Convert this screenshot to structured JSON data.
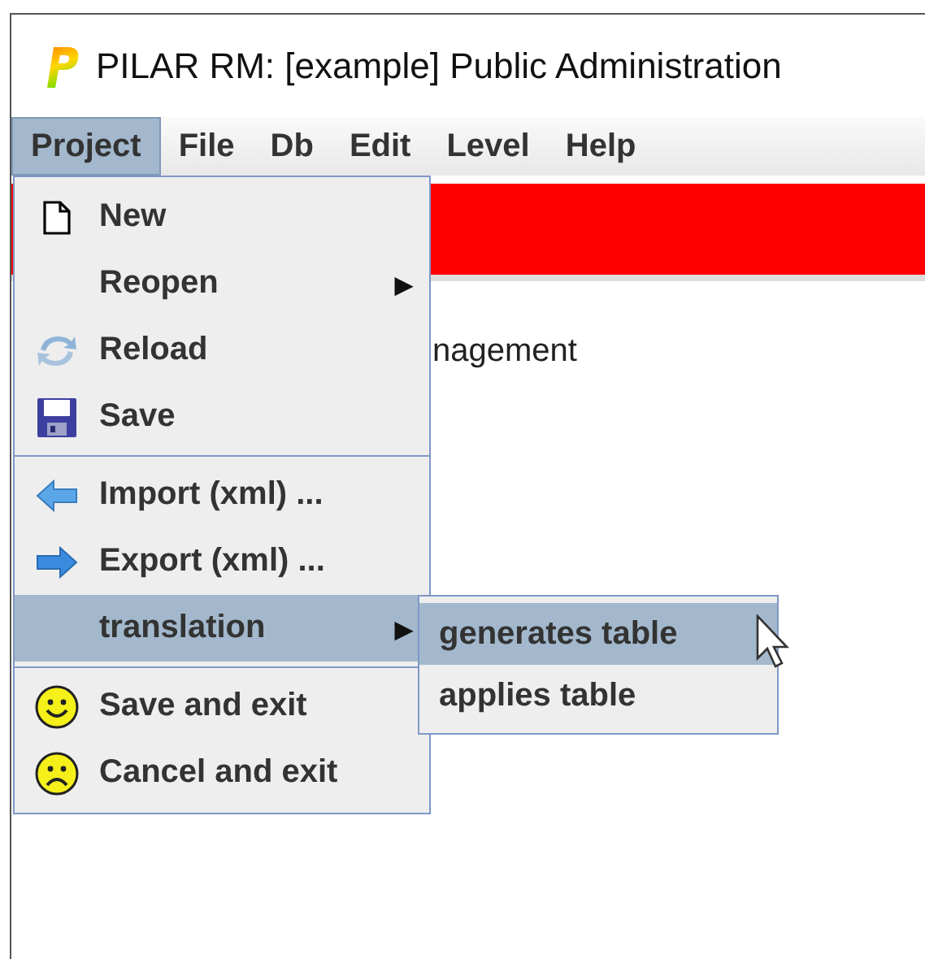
{
  "window": {
    "title": "PILAR RM: [example] Public Administration"
  },
  "menubar": [
    {
      "label": "Project",
      "selected": true
    },
    {
      "label": "File",
      "selected": false
    },
    {
      "label": "Db",
      "selected": false
    },
    {
      "label": "Edit",
      "selected": false
    },
    {
      "label": "Level",
      "selected": false
    },
    {
      "label": "Help",
      "selected": false
    }
  ],
  "content": {
    "text": "nagement"
  },
  "menu": [
    {
      "kind": "item",
      "label": "New",
      "selected": false
    },
    {
      "kind": "submenu",
      "label": "Reopen",
      "arrow": "▶",
      "selected": false
    },
    {
      "kind": "item",
      "label": "Reload",
      "selected": false
    },
    {
      "kind": "item",
      "label": "Save",
      "selected": false
    },
    {
      "kind": "separator"
    },
    {
      "kind": "item",
      "label": "Import (xml) ...",
      "selected": false
    },
    {
      "kind": "item",
      "label": "Export (xml) ...",
      "selected": false
    },
    {
      "kind": "submenu",
      "label": "translation",
      "arrow": "▶",
      "selected": true
    },
    {
      "kind": "separator"
    },
    {
      "kind": "item",
      "label": "Save and exit",
      "selected": false
    },
    {
      "kind": "item",
      "label": "Cancel and exit",
      "selected": false
    }
  ],
  "submenu": [
    {
      "label": "generates table",
      "selected": true
    },
    {
      "label": "applies table",
      "selected": false
    }
  ]
}
